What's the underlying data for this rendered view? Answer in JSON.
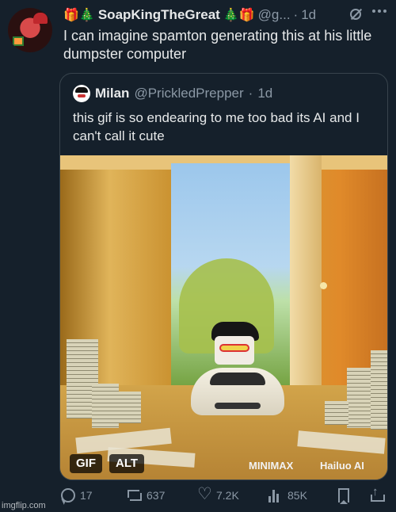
{
  "tweet": {
    "emoji_left": "🎁🎄",
    "display_name": "SoapKingTheGreat",
    "emoji_right": "🎄🎁",
    "handle": "@g...",
    "sep": "·",
    "time": "1d",
    "text": "I can imagine spamton generating this at his little dumpster computer"
  },
  "quote": {
    "display_name": "Milan",
    "handle": "@PrickledPrepper",
    "sep": "·",
    "time": "1d",
    "text": "this gif is so endearing to me too bad its AI and I can't call it cute",
    "media": {
      "gif_badge": "GIF",
      "alt_badge": "ALT",
      "watermark_left": "MINIMAX",
      "watermark_right": "Hailuo AI"
    }
  },
  "actions": {
    "replies": "17",
    "reposts": "637",
    "likes": "7.2K",
    "views": "85K"
  },
  "icons": [
    "more-icon",
    "grok-icon",
    "reply-icon",
    "repost-icon",
    "like-icon",
    "views-icon",
    "bookmark-icon",
    "share-icon"
  ],
  "footer": {
    "watermark": "imgflip.com"
  }
}
